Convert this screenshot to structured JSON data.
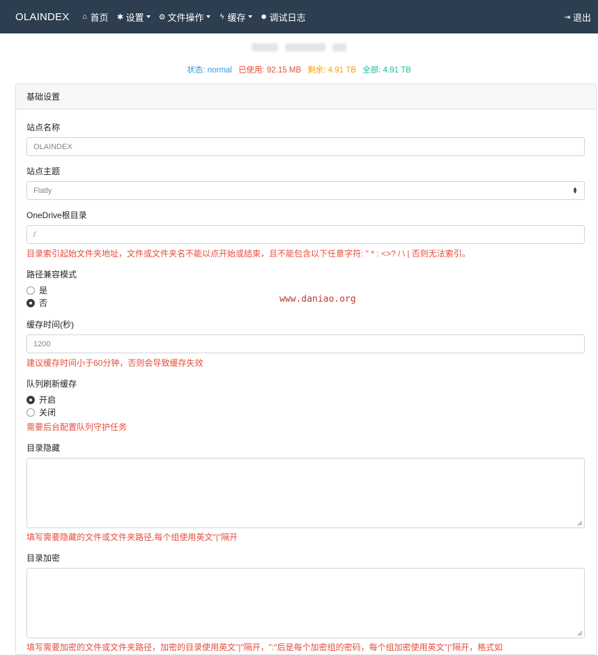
{
  "navbar": {
    "brand": "OLAINDEX",
    "items": [
      {
        "label": "首页",
        "icon": "home-icon"
      },
      {
        "label": "设置",
        "icon": "gear-icon",
        "dropdown": true
      },
      {
        "label": "文件操作",
        "icon": "cogs-icon",
        "dropdown": true
      },
      {
        "label": "缓存",
        "icon": "bolt-icon",
        "dropdown": true
      },
      {
        "label": "调试日志",
        "icon": "bug-icon"
      }
    ],
    "logout": {
      "label": "退出",
      "icon": "sign-out-icon"
    }
  },
  "status": {
    "state": "状态: normal",
    "used": "已使用: 92.15 MB",
    "remaining": "剩余: 4.91 TB",
    "total": "全部: 4.91 TB"
  },
  "card": {
    "header": "基础设置",
    "site_name": {
      "label": "站点名称",
      "value": "OLAINDEX"
    },
    "site_theme": {
      "label": "站点主题",
      "value": "Flatly"
    },
    "root_dir": {
      "label": "OneDrive根目录",
      "value": "/",
      "help": "目录索引起始文件夹地址，文件或文件夹名不能以点开始或结束，且不能包含以下任意字符: \" * : <>? / \\ | 否则无法索引。"
    },
    "path_compat": {
      "label": "路径兼容模式",
      "options": [
        "是",
        "否"
      ],
      "selected": "否"
    },
    "cache_time": {
      "label": "缓存时间(秒)",
      "value": "1200",
      "help": "建议缓存时间小于60分钟，否则会导致缓存失效"
    },
    "queue_refresh": {
      "label": "队列刷新缓存",
      "options": [
        "开启",
        "关闭"
      ],
      "selected": "开启",
      "help": "需要后台配置队列守护任务"
    },
    "hide_dir": {
      "label": "目录隐藏",
      "help": "填写需要隐藏的文件或文件夹路径,每个组使用英文\"|\"隔开"
    },
    "encrypt_dir": {
      "label": "目录加密",
      "help": "填写需要加密的文件或文件夹路径，加密的目录使用英文\"|\"隔开，\":\"后是每个加密组的密码，每个组加密使用英文\"|\"隔开，格式如"
    }
  },
  "watermark": "www.daniao.org",
  "colors": {
    "navbar": "#2c3e50",
    "danger": "#e74c3c",
    "info": "#3498db",
    "warning": "#f39c12",
    "success": "#18bc9c"
  }
}
